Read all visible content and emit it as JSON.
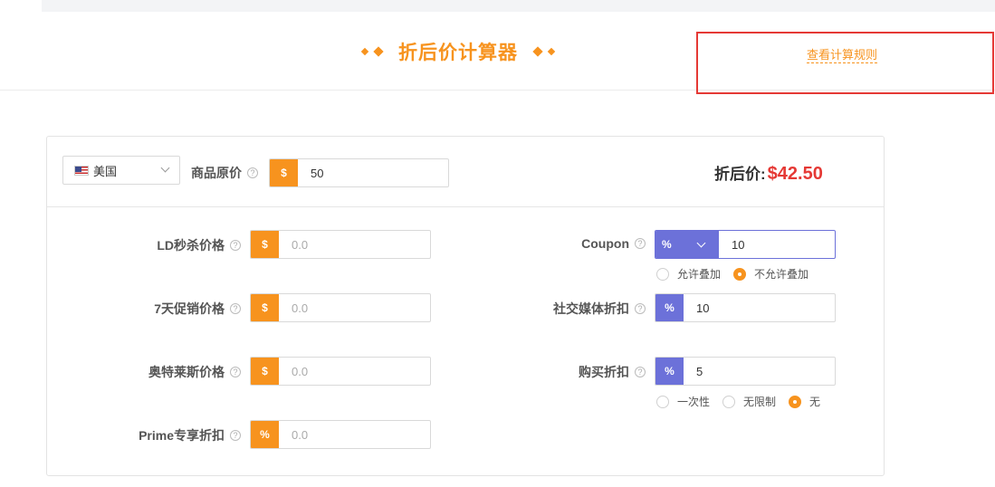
{
  "header": {
    "title": "折后价计算器",
    "rules_link": "查看计算规则"
  },
  "top": {
    "country": "美国",
    "original_price_label": "商品原价",
    "original_price_addon": "$",
    "original_price_value": "50",
    "result_label": "折后价:",
    "result_value": "$42.50"
  },
  "left_fields": [
    {
      "label": "LD秒杀价格",
      "addon": "$",
      "placeholder": "0.0"
    },
    {
      "label": "7天促销价格",
      "addon": "$",
      "placeholder": "0.0"
    },
    {
      "label": "奥特莱斯价格",
      "addon": "$",
      "placeholder": "0.0"
    },
    {
      "label": "Prime专享折扣",
      "addon": "%",
      "placeholder": "0.0"
    }
  ],
  "coupon": {
    "label": "Coupon",
    "type_selected": "%",
    "value": "10",
    "options": [
      {
        "label": "允许叠加",
        "selected": false
      },
      {
        "label": "不允许叠加",
        "selected": true
      }
    ]
  },
  "social": {
    "label": "社交媒体折扣",
    "addon": "%",
    "value": "10"
  },
  "purchase": {
    "label": "购买折扣",
    "addon": "%",
    "value": "5",
    "options": [
      {
        "label": "一次性",
        "selected": false
      },
      {
        "label": "无限制",
        "selected": false
      },
      {
        "label": "无",
        "selected": true
      }
    ]
  },
  "help_glyph": "?",
  "colors": {
    "accent": "#f7931e",
    "blue_addon": "#6c71d9",
    "result": "#e53935",
    "highlight_box": "#e53935"
  }
}
